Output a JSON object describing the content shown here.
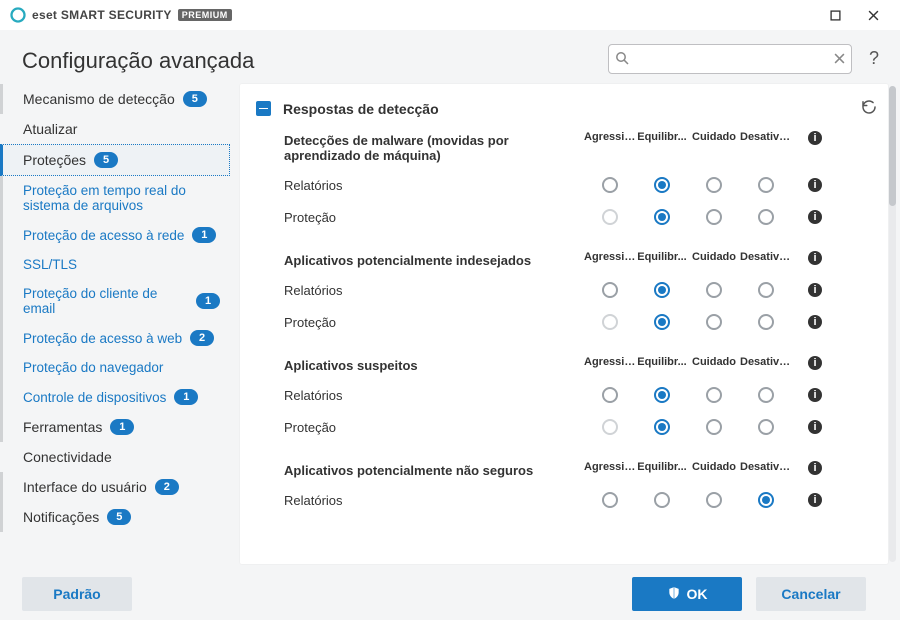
{
  "titlebar": {
    "brand_eset": "eset",
    "brand_product": "SMART SECURITY",
    "brand_edition": "PREMIUM"
  },
  "page_title": "Configuração avançada",
  "search": {
    "placeholder": ""
  },
  "sidebar": [
    {
      "type": "top",
      "key": "mecanismo",
      "label": "Mecanismo de detecção",
      "badge": "5",
      "bar": true
    },
    {
      "type": "section",
      "key": "atualizar",
      "label": "Atualizar"
    },
    {
      "type": "top",
      "key": "protecoes",
      "label": "Proteções",
      "badge": "5",
      "selected": true
    },
    {
      "type": "sub",
      "key": "rtfs",
      "label": "Proteção em tempo real do sistema de arquivos",
      "bar": true
    },
    {
      "type": "sub",
      "key": "rede",
      "label": "Proteção de acesso à rede",
      "badge": "1",
      "bar": true
    },
    {
      "type": "sub",
      "key": "ssl",
      "label": "SSL/TLS",
      "bar": true
    },
    {
      "type": "sub",
      "key": "email",
      "label": "Proteção do cliente de email",
      "badge": "1",
      "bar": true
    },
    {
      "type": "sub",
      "key": "web",
      "label": "Proteção de acesso à web",
      "badge": "2",
      "bar": true
    },
    {
      "type": "sub",
      "key": "navegador",
      "label": "Proteção do navegador",
      "bar": true
    },
    {
      "type": "sub",
      "key": "dispositivos",
      "label": "Controle de dispositivos",
      "badge": "1",
      "bar": true
    },
    {
      "type": "section",
      "key": "ferramentas",
      "label": "Ferramentas",
      "badge": "1",
      "bar": true
    },
    {
      "type": "section",
      "key": "conectividade",
      "label": "Conectividade"
    },
    {
      "type": "section",
      "key": "interface",
      "label": "Interface do usuário",
      "badge": "2",
      "bar": true
    },
    {
      "type": "section",
      "key": "notificacoes",
      "label": "Notificações",
      "badge": "5",
      "bar": true
    }
  ],
  "panel": {
    "title": "Respostas de detecção",
    "columns": [
      "Agressivo",
      "Equilibr...",
      "Cuidado",
      "Desativa..."
    ],
    "groups": [
      {
        "title": "Detecções de malware (movidas por aprendizado de máquina)",
        "rows": [
          {
            "label": "Relatórios",
            "selected": 1,
            "disabled": []
          },
          {
            "label": "Proteção",
            "selected": 1,
            "disabled": [
              0
            ]
          }
        ]
      },
      {
        "title": "Aplicativos potencialmente indesejados",
        "rows": [
          {
            "label": "Relatórios",
            "selected": 1,
            "disabled": []
          },
          {
            "label": "Proteção",
            "selected": 1,
            "disabled": [
              0
            ]
          }
        ]
      },
      {
        "title": "Aplicativos suspeitos",
        "rows": [
          {
            "label": "Relatórios",
            "selected": 1,
            "disabled": []
          },
          {
            "label": "Proteção",
            "selected": 1,
            "disabled": [
              0
            ]
          }
        ]
      },
      {
        "title": "Aplicativos potencialmente não seguros",
        "rows": [
          {
            "label": "Relatórios",
            "selected": 3,
            "disabled": []
          }
        ]
      }
    ]
  },
  "footer": {
    "default_label": "Padrão",
    "ok_label": "OK",
    "cancel_label": "Cancelar"
  }
}
